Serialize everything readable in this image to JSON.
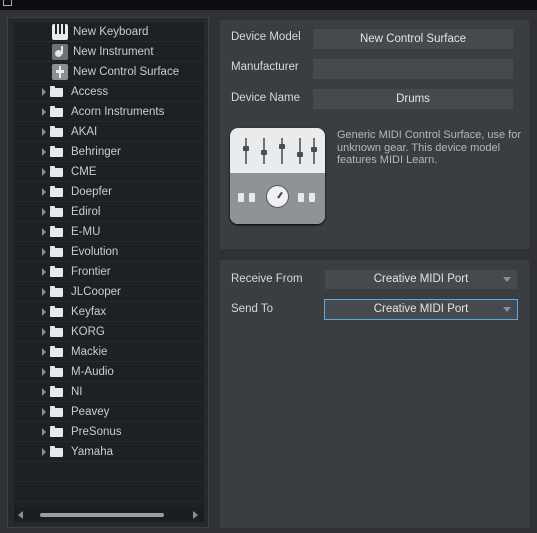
{
  "device_items": [
    {
      "label": "New Keyboard",
      "icon": "keyboard-icon"
    },
    {
      "label": "New Instrument",
      "icon": "instrument-icon"
    },
    {
      "label": "New Control Surface",
      "icon": "control-surface-icon"
    }
  ],
  "manufacturers": [
    "Access",
    "Acorn Instruments",
    "AKAI",
    "Behringer",
    "CME",
    "Doepfer",
    "Edirol",
    "E-MU",
    "Evolution",
    "Frontier",
    "JLCooper",
    "Keyfax",
    "KORG",
    "Mackie",
    "M-Audio",
    "NI",
    "Peavey",
    "PreSonus",
    "Yamaha"
  ],
  "device": {
    "model_label": "Device Model",
    "model_value": "New Control Surface",
    "manufacturer_label": "Manufacturer",
    "manufacturer_value": "",
    "name_label": "Device Name",
    "name_value": "Drums",
    "description": "Generic MIDI Control Surface, use for unknown gear. This device model features MIDI Learn."
  },
  "ports": {
    "receive_label": "Receive From",
    "receive_value": "Creative MIDI Port",
    "send_label": "Send To",
    "send_value": "Creative MIDI Port"
  },
  "colors": {
    "panel": "#3a3d42",
    "field": "#46494e",
    "focus": "#5aa7e6"
  }
}
